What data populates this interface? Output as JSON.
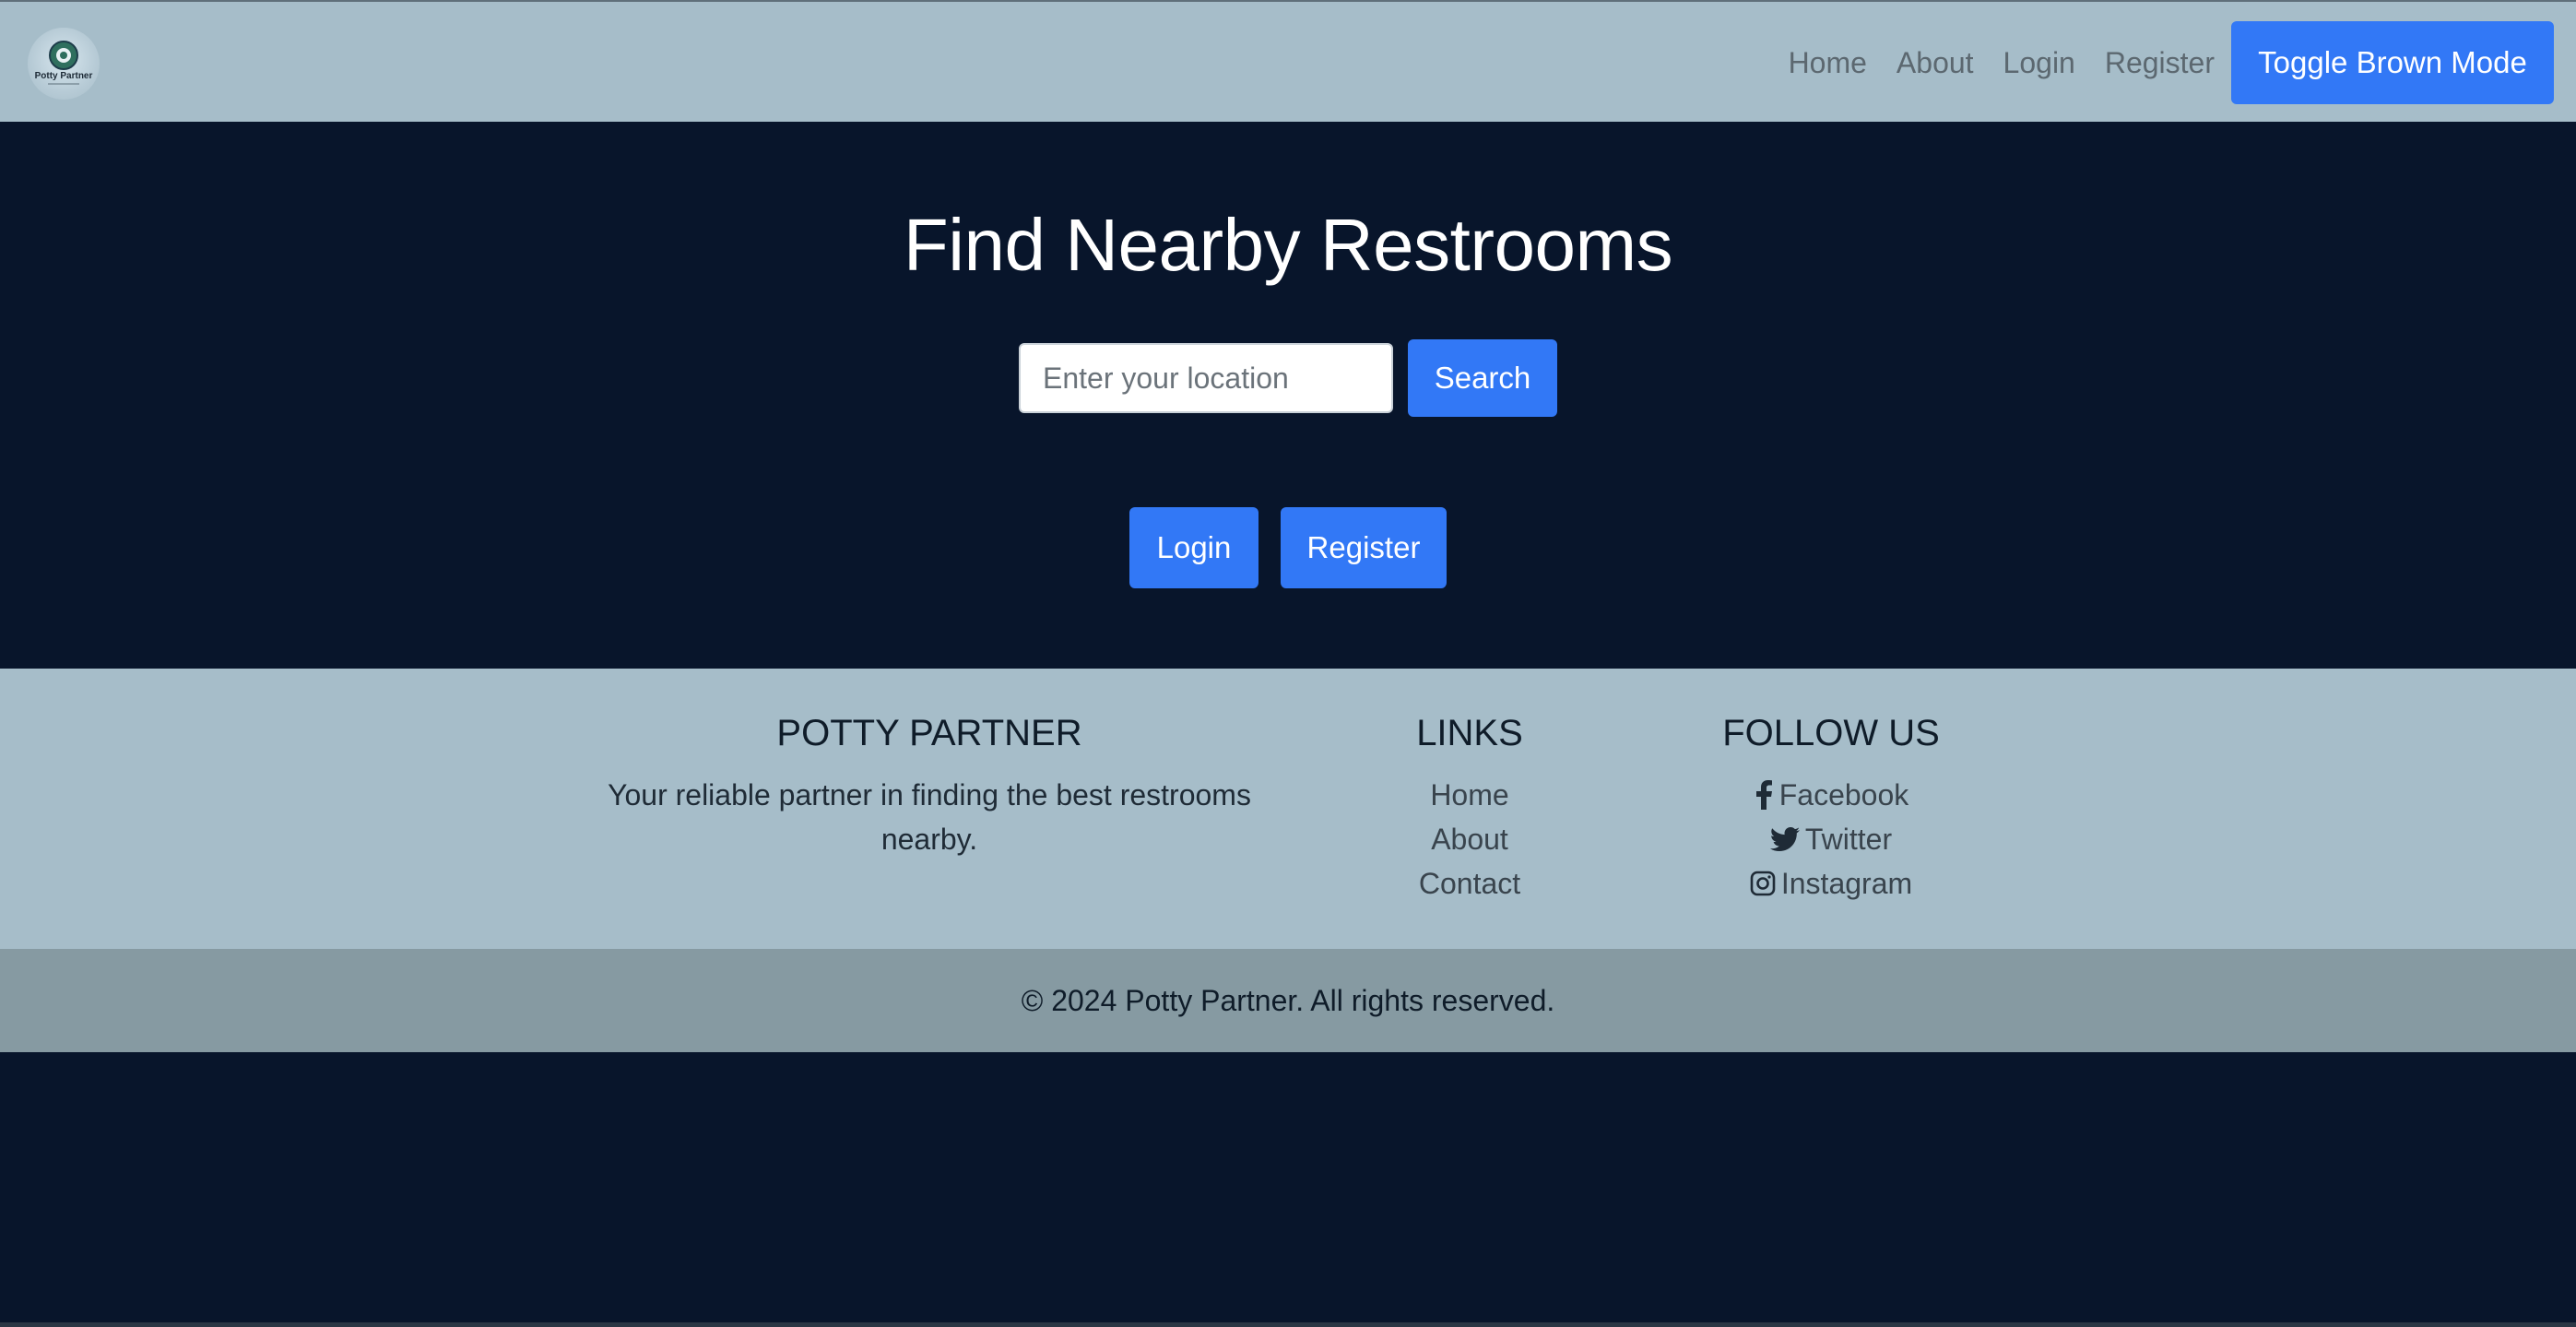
{
  "navbar": {
    "brand_icon": "potty-partner-logo",
    "brand_text": "Potty Partner",
    "links": [
      "Home",
      "About",
      "Login",
      "Register"
    ],
    "toggle_label": "Toggle Brown Mode"
  },
  "hero": {
    "title": "Find Nearby Restrooms",
    "search_placeholder": "Enter your location",
    "search_label": "Search",
    "login_label": "Login",
    "register_label": "Register"
  },
  "footer": {
    "about": {
      "heading": "POTTY PARTNER",
      "text_line1": "Your reliable partner in finding the best restrooms",
      "text_line2": "nearby."
    },
    "links": {
      "heading": "LINKS",
      "items": [
        "Home",
        "About",
        "Contact"
      ]
    },
    "follow": {
      "heading": "FOLLOW US",
      "items": [
        {
          "icon": "facebook-icon",
          "label": "Facebook"
        },
        {
          "icon": "twitter-icon",
          "label": "Twitter"
        },
        {
          "icon": "instagram-icon",
          "label": "Instagram"
        }
      ]
    },
    "copyright": "© 2024 Potty Partner. All rights reserved."
  },
  "colors": {
    "navbar_bg": "#a6bdc9",
    "page_bg": "#08152b",
    "accent": "#3278f6",
    "footer_bottom_bg": "#869aa2"
  }
}
